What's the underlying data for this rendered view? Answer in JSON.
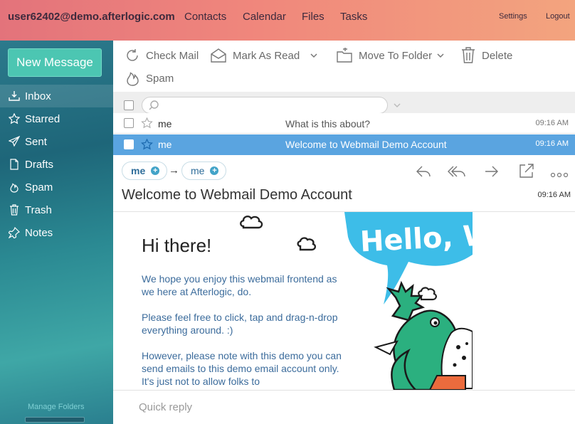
{
  "header": {
    "user": "user62402@demo.afterlogic.com",
    "nav": [
      "Contacts",
      "Calendar",
      "Files",
      "Tasks"
    ],
    "settings": "Settings",
    "logout": "Logout"
  },
  "sidebar": {
    "new_message": "New Message",
    "folders": [
      {
        "label": "Inbox",
        "icon": "inbox-icon"
      },
      {
        "label": "Starred",
        "icon": "star-icon"
      },
      {
        "label": "Sent",
        "icon": "send-icon"
      },
      {
        "label": "Drafts",
        "icon": "draft-icon"
      },
      {
        "label": "Spam",
        "icon": "flame-icon"
      },
      {
        "label": "Trash",
        "icon": "trash-icon"
      },
      {
        "label": "Notes",
        "icon": "pin-icon"
      }
    ],
    "manage_folders": "Manage Folders"
  },
  "toolbar": {
    "check_mail": "Check Mail",
    "mark_as_read": "Mark As Read",
    "move_to_folder": "Move To Folder",
    "delete": "Delete",
    "spam": "Spam"
  },
  "messages": [
    {
      "from": "me",
      "subject": "What is this about?",
      "time": "09:16 AM"
    },
    {
      "from": "me",
      "subject": "Welcome to Webmail Demo Account",
      "time": "09:16 AM"
    }
  ],
  "message_view": {
    "from": "me",
    "to": "me",
    "arrow": "→",
    "subject": "Welcome to Webmail Demo Account",
    "time": "09:16 AM",
    "greeting": "Hi there!",
    "paragraphs": [
      "We hope you enjoy this webmail frontend as we here at Afterlogic, do.",
      "Please feel free to click, tap and drag-n-drop everything around. :)",
      "However, please note with this demo you can send emails to this demo email account only. It's just not to allow folks to"
    ],
    "image_text": "Hello, World!",
    "quick_reply": "Quick reply"
  },
  "colors": {
    "accent": "#4cc6b2",
    "selected_row": "#5aa4e0",
    "link_text": "#3c6c9c"
  }
}
